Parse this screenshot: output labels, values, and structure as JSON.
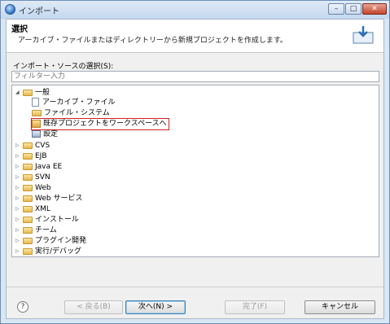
{
  "window": {
    "title": "インポート",
    "min_glyph": "–",
    "max_glyph": "□",
    "close_glyph": "✕"
  },
  "header": {
    "title": "選択",
    "description": "アーカイブ・ファイルまたはディレクトリーから新規プロジェクトを作成します。"
  },
  "source": {
    "label": "インポート・ソースの選択(S):",
    "filter_placeholder": "フィルター入力"
  },
  "tree": {
    "expanded_glyph": "◢",
    "collapsed_glyph": "▷",
    "general": {
      "label": "一般",
      "children": [
        {
          "label": "アーカイブ・ファイル",
          "icon": "archive-file-icon"
        },
        {
          "label": "ファイル・システム",
          "icon": "folder-icon"
        },
        {
          "label": "既存プロジェクトをワークスペースへ",
          "icon": "project-icon",
          "selected": true
        },
        {
          "label": "設定",
          "icon": "settings-icon"
        }
      ]
    },
    "categories": [
      {
        "label": "CVS"
      },
      {
        "label": "EJB"
      },
      {
        "label": "Java EE"
      },
      {
        "label": "SVN"
      },
      {
        "label": "Web"
      },
      {
        "label": "Web サービス"
      },
      {
        "label": "XML"
      },
      {
        "label": "インストール"
      },
      {
        "label": "チーム"
      },
      {
        "label": "プラグイン開発"
      },
      {
        "label": "実行/デバッグ"
      }
    ]
  },
  "buttons": {
    "help_glyph": "?",
    "back": "< 戻る(B)",
    "next": "次へ(N) >",
    "finish": "完了(F)",
    "cancel": "キャンセル"
  },
  "colors": {
    "selection_outline": "#d21f1f"
  }
}
